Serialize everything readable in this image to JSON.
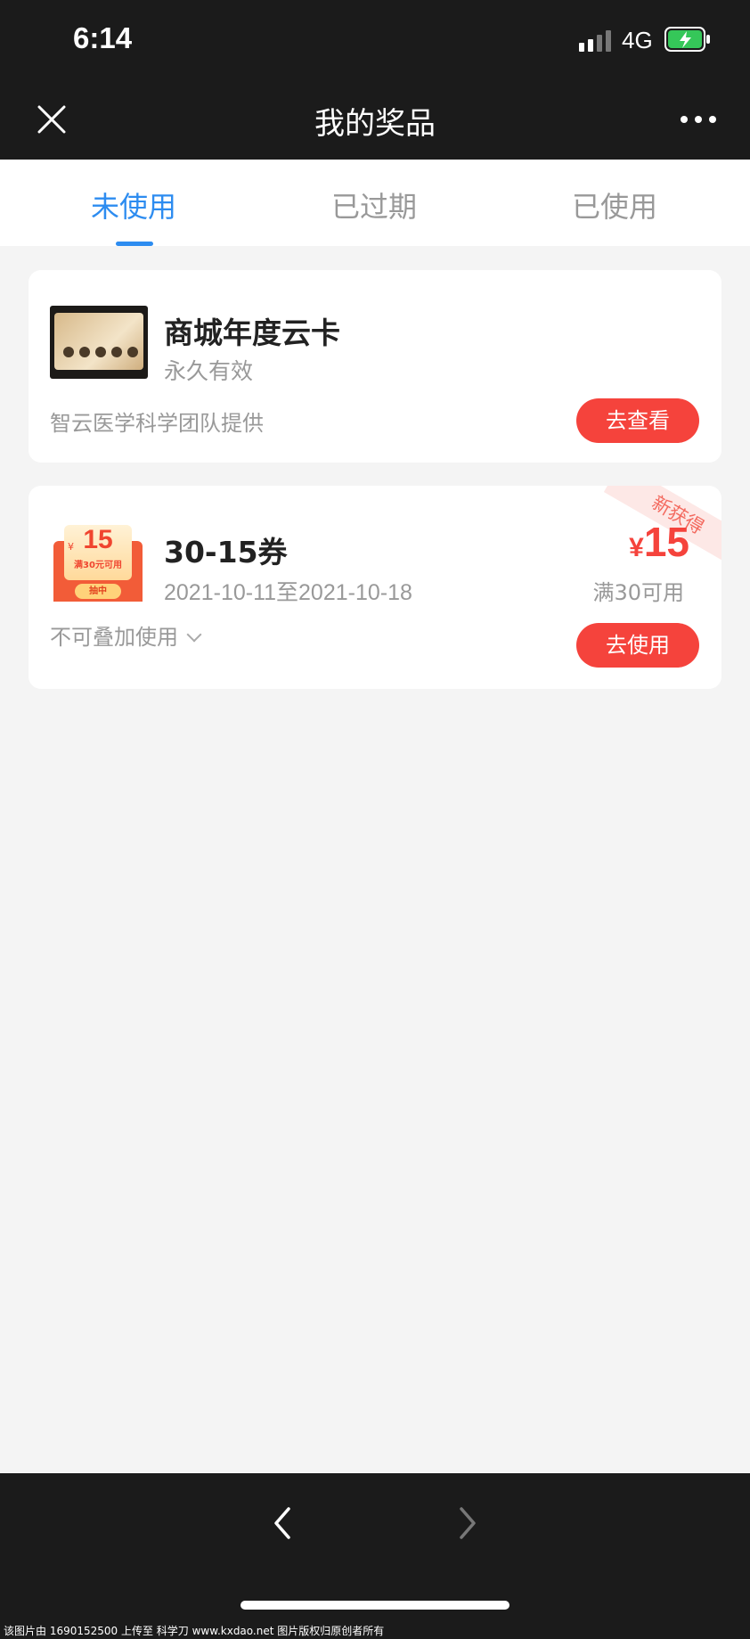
{
  "status_bar": {
    "time": "6:14",
    "network": "4G",
    "battery_color": "#35c759"
  },
  "header": {
    "title": "我的奖品",
    "close_icon": "close-icon",
    "more_icon": "more-icon"
  },
  "tabs": [
    {
      "label": "未使用",
      "active": true
    },
    {
      "label": "已过期",
      "active": false
    },
    {
      "label": "已使用",
      "active": false
    }
  ],
  "prizes": [
    {
      "title": "商城年度云卡",
      "validity": "永久有效",
      "provider": "智云医学科学团队提供",
      "button": "去查看"
    },
    {
      "title": "30-15券",
      "validity": "2021-10-11至2021-10-18",
      "badge": "新获得",
      "price_symbol": "¥",
      "price_value": "15",
      "condition": "满30可用",
      "icon_symbol": "¥",
      "icon_amount": "15",
      "icon_condition": "满30元可用",
      "icon_draw": "抽中",
      "stack_rule": "不可叠加使用",
      "button": "去使用"
    }
  ],
  "footer": {
    "watermark": "该图片由 1690152500 上传至 科学刀 www.kxdao.net 图片版权归原创者所有"
  },
  "colors": {
    "accent_blue": "#2d8cf0",
    "accent_red": "#f5433c",
    "dark_bar": "#1b1b1b",
    "page_bg": "#f4f4f4"
  }
}
